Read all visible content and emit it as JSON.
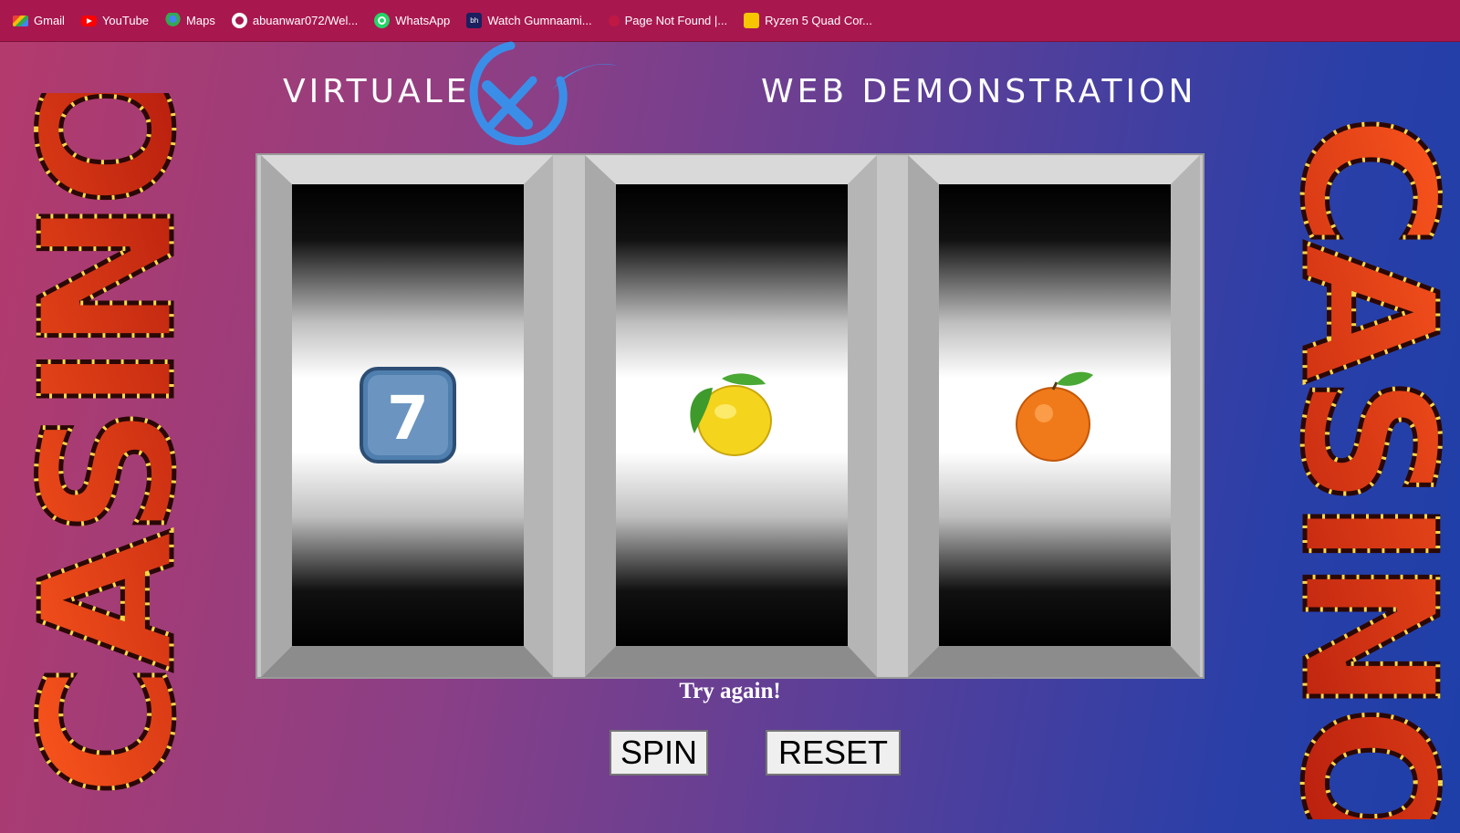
{
  "bookmarks": [
    {
      "label": "Gmail",
      "icon": "gmail-icon"
    },
    {
      "label": "YouTube",
      "icon": "youtube-icon"
    },
    {
      "label": "Maps",
      "icon": "maps-icon"
    },
    {
      "label": "abuanwar072/Wel...",
      "icon": "github-icon"
    },
    {
      "label": "WhatsApp",
      "icon": "whatsapp-icon"
    },
    {
      "label": "Watch Gumnaami...",
      "icon": "bh-icon"
    },
    {
      "label": "Page Not Found |...",
      "icon": "page-not-found-icon"
    },
    {
      "label": "Ryzen 5 Quad Cor...",
      "icon": "ryzen-icon"
    }
  ],
  "header": {
    "brand_left": "VIRTUALE",
    "brand_right": "WEB DEMONSTRATION"
  },
  "side_sign": {
    "text": "CASINO"
  },
  "reels": [
    {
      "symbol": "seven",
      "label": "7"
    },
    {
      "symbol": "lemon"
    },
    {
      "symbol": "orange"
    }
  ],
  "message": "Try again!",
  "buttons": {
    "spin": "SPIN",
    "reset": "RESET"
  },
  "colors": {
    "bookmark_bar": "#a9174f",
    "logo_x": "#3a8ee8",
    "bulb": "#ffcf3a",
    "sign_red": "#d42a12"
  }
}
